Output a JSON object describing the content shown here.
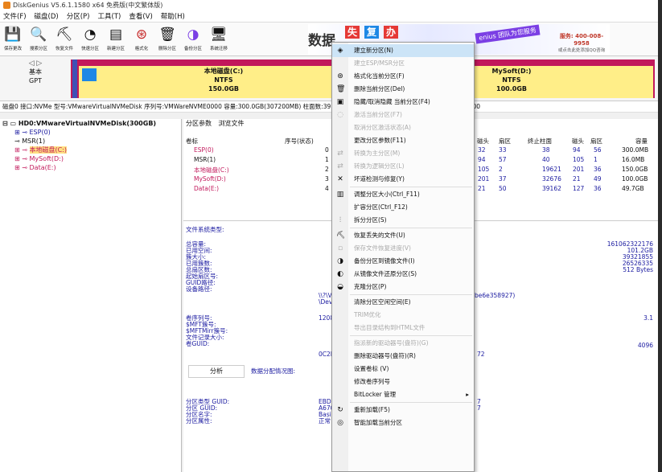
{
  "title": "DiskGenius V5.6.1.1580 x64 免费版(中文繁体版)",
  "menu": [
    "文件(F)",
    "磁盘(D)",
    "分区(P)",
    "工具(T)",
    "查看(V)",
    "帮助(H)"
  ],
  "toolbar": [
    {
      "label": "保存更改",
      "icon": "save-icon",
      "glyph": "💾"
    },
    {
      "label": "搜索分区",
      "icon": "search-icon",
      "glyph": "🔍"
    },
    {
      "label": "恢复文件",
      "icon": "recover-icon",
      "glyph": "⛏"
    },
    {
      "label": "快速分区",
      "icon": "quick-partition-icon",
      "glyph": "◔"
    },
    {
      "label": "新建分区",
      "icon": "new-partition-icon",
      "glyph": "▤"
    },
    {
      "label": "格式化",
      "icon": "format-icon",
      "glyph": "⊛"
    },
    {
      "label": "删除分区",
      "icon": "delete-icon",
      "glyph": "🗑"
    },
    {
      "label": "备份分区",
      "icon": "backup-icon",
      "glyph": "◑"
    },
    {
      "label": "系统迁移",
      "icon": "migrate-icon",
      "glyph": "🖥"
    }
  ],
  "banner": {
    "big": "数据",
    "tiles": [
      "失",
      "复",
      "办"
    ],
    "slogan": "enius 团队为您服务",
    "phone": "服务: 400-008-9958",
    "phone_sub": "或点击此处添加QQ咨询"
  },
  "disk_nav": {
    "arrows": "◁ ▷",
    "line1": "基本",
    "line2": "GPT"
  },
  "partitions": [
    {
      "name": "本地磁盘(C:)",
      "fs": "NTFS",
      "size": "150.0GB"
    },
    {
      "name": "MySoft(D:)",
      "fs": "NTFS",
      "size": "100.0GB"
    }
  ],
  "info_line": "磁盘0 接口:NVMe  型号:VMwareVirtualNVMeDisk  序列号:VMWareNVME0000  容量:300.0GB(307200MB)  柱面数:39162  磁头数:255  每道扇区数:63  总扇区数:629145600",
  "tree": {
    "disk": "HD0:VMwareVirtualNVMeDisk(300GB)",
    "items": [
      "ESP(0)",
      "MSR(1)",
      "本地磁盘(C:)",
      "MySoft(D:)",
      "Data(E:)"
    ]
  },
  "tabs": [
    "分区参数",
    "浏览文件"
  ],
  "table": {
    "headers": [
      "卷标",
      "序号(状态)",
      "磁头",
      "扇区",
      "终止柱面",
      "磁头",
      "扇区",
      "容量"
    ],
    "rows": [
      {
        "label": "ESP(0)",
        "num": "0",
        "h1": "32",
        "s1": "33",
        "ec": "38",
        "h2": "94",
        "s2": "56",
        "cap": "300.0MB"
      },
      {
        "label": "MSR(1)",
        "num": "1",
        "h1": "94",
        "s1": "57",
        "ec": "40",
        "h2": "105",
        "s2": "1",
        "cap": "16.0MB"
      },
      {
        "label": "本地磁盘(C:)",
        "num": "2",
        "h1": "105",
        "s1": "2",
        "ec": "19621",
        "h2": "201",
        "s2": "36",
        "cap": "150.0GB"
      },
      {
        "label": "MySoft(D:)",
        "num": "3",
        "h1": "201",
        "s1": "37",
        "ec": "32676",
        "h2": "21",
        "s2": "49",
        "cap": "100.0GB"
      },
      {
        "label": "Data(E:)",
        "num": "4",
        "h1": "21",
        "s1": "50",
        "ec": "39162",
        "h2": "127",
        "s2": "36",
        "cap": "49.7GB"
      }
    ]
  },
  "details": {
    "fs_type_label": "文件系统类型:",
    "group1": [
      "总容量:",
      "已用空间:",
      "簇大小:",
      "已用簇数:",
      "总扇区数:",
      "起始扇区号:",
      "GUID路径:",
      "设备路径:"
    ],
    "group1_values": [
      "161062322176",
      "101.2GB",
      "39321855",
      "26526335",
      "512 Bytes"
    ],
    "guid_path": "\\\\?\\V",
    "device_path": "\\Dev",
    "guid_tail": "be6e358927)",
    "group2": [
      "卷序列号:",
      "$MFT簇号:",
      "$MFTMirr簇号:",
      "文件记录大小:",
      "卷GUID:"
    ],
    "serial_prefix": "1208-",
    "ver": "3.1",
    "record_size": "4096",
    "vol_guid_prefix": "0C2E",
    "vol_guid_tail": "72",
    "analyze": "分析",
    "dist_label": "数据分配情况图:",
    "group3": [
      "分区类型 GUID:",
      "分区 GUID:",
      "分区名字:",
      "分区属性:"
    ],
    "group3_values": [
      "EBD0",
      "A670",
      "Basic",
      "正常"
    ],
    "group3_tail": [
      "7",
      "7"
    ]
  },
  "context_menu": [
    {
      "label": "建立新分区(N)",
      "icon": "new-partition-icon",
      "glyph": "◈",
      "disabled": false,
      "hl": true
    },
    {
      "label": "建立ESP/MSR分区",
      "icon": "esp-icon",
      "glyph": "",
      "disabled": true
    },
    {
      "label": "格式化当前分区(F)",
      "icon": "format-icon",
      "glyph": "⊛",
      "disabled": false
    },
    {
      "label": "删除当前分区(Del)",
      "icon": "delete-icon",
      "glyph": "🗑",
      "disabled": false
    },
    {
      "label": "隐藏/取消隐藏 当前分区(F4)",
      "icon": "hide-icon",
      "glyph": "▣",
      "disabled": false
    },
    {
      "label": "激活当前分区(F7)",
      "icon": "activate-icon",
      "glyph": "◌",
      "disabled": true
    },
    {
      "label": "取消分区激活状态(A)",
      "icon": "",
      "glyph": "",
      "disabled": true
    },
    {
      "label": "更改分区参数(F11)",
      "icon": "",
      "glyph": "",
      "disabled": false
    },
    {
      "label": "转换为主分区(M)",
      "icon": "convert-icon",
      "glyph": "⇄",
      "disabled": true
    },
    {
      "label": "转换为逻辑分区(L)",
      "icon": "convert-icon",
      "glyph": "⇄",
      "disabled": true
    },
    {
      "label": "坏道检测与修复(Y)",
      "icon": "tool-icon",
      "glyph": "✕",
      "disabled": false
    },
    {
      "label": "调整分区大小(Ctrl_F11)",
      "icon": "resize-icon",
      "glyph": "▥",
      "disabled": false
    },
    {
      "label": "扩容分区(Ctrl_F12)",
      "icon": "",
      "glyph": "",
      "disabled": false
    },
    {
      "label": "拆分分区(S)",
      "icon": "split-icon",
      "glyph": "⫶",
      "disabled": false
    },
    {
      "label": "恢复丢失的文件(U)",
      "icon": "recover-icon",
      "glyph": "⛏",
      "disabled": false
    },
    {
      "label": "保存文件恢复进度(V)",
      "icon": "save-icon",
      "glyph": "▫",
      "disabled": true
    },
    {
      "label": "备份分区到镜像文件(I)",
      "icon": "backup-icon",
      "glyph": "◑",
      "disabled": false
    },
    {
      "label": "从镜像文件还原分区(S)",
      "icon": "restore-icon",
      "glyph": "◐",
      "disabled": false
    },
    {
      "label": "克隆分区(P)",
      "icon": "clone-icon",
      "glyph": "◒",
      "disabled": false
    },
    {
      "label": "清除分区空闲空间(E)",
      "icon": "",
      "glyph": "",
      "disabled": false
    },
    {
      "label": "TRIM优化",
      "icon": "",
      "glyph": "",
      "disabled": true
    },
    {
      "label": "导出目录结构到HTML文件",
      "icon": "",
      "glyph": "",
      "disabled": true
    },
    {
      "label": "指派新的驱动器号(盘符)(G)",
      "icon": "",
      "glyph": "",
      "disabled": true
    },
    {
      "label": "删除驱动器号(盘符)(R)",
      "icon": "",
      "glyph": "",
      "disabled": false
    },
    {
      "label": "设置卷标 (V)",
      "icon": "",
      "glyph": "",
      "disabled": false
    },
    {
      "label": "修改卷序列号",
      "icon": "",
      "glyph": "",
      "disabled": false
    },
    {
      "label": "BitLocker 管理",
      "icon": "",
      "glyph": "",
      "disabled": false,
      "submenu": true
    },
    {
      "label": "重新加载(F5)",
      "icon": "reload-icon",
      "glyph": "↻",
      "disabled": false
    },
    {
      "label": "智能加载当前分区",
      "icon": "smart-load-icon",
      "glyph": "◎",
      "disabled": false
    }
  ],
  "colors": {
    "accent_magenta": "#c2185b",
    "partition_fill": "#ffee88",
    "blue_seg": "#1e88e5",
    "menu_highlight": "#cce4f7"
  }
}
